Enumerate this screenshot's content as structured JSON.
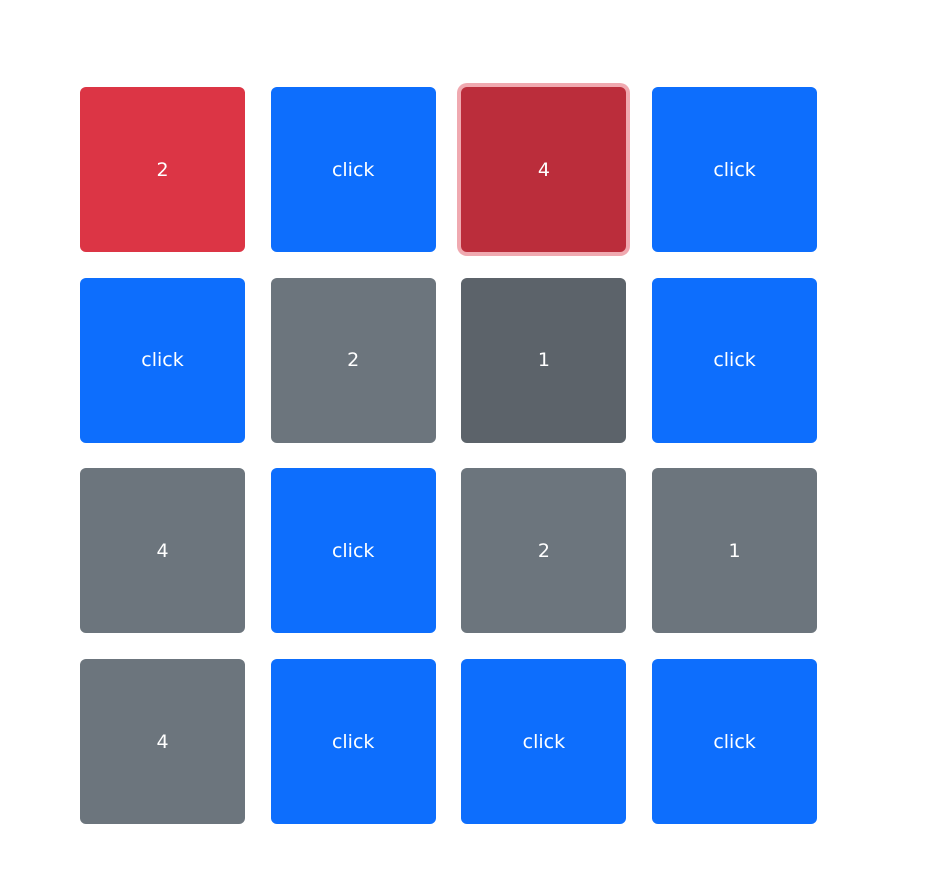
{
  "colors": {
    "hidden": "#0d6efd",
    "matched": "#6c757d",
    "matched_active": "#5c636a",
    "revealed": "#dc3545",
    "revealed_focus": "#bb2d3b"
  },
  "tiles": [
    {
      "label": "2",
      "state": "revealed"
    },
    {
      "label": "click",
      "state": "hidden"
    },
    {
      "label": "4",
      "state": "revealed-focus"
    },
    {
      "label": "click",
      "state": "hidden"
    },
    {
      "label": "click",
      "state": "hidden"
    },
    {
      "label": "2",
      "state": "matched"
    },
    {
      "label": "1",
      "state": "matched-active"
    },
    {
      "label": "click",
      "state": "hidden"
    },
    {
      "label": "4",
      "state": "matched"
    },
    {
      "label": "click",
      "state": "hidden"
    },
    {
      "label": "2",
      "state": "matched"
    },
    {
      "label": "1",
      "state": "matched"
    },
    {
      "label": "4",
      "state": "matched"
    },
    {
      "label": "click",
      "state": "hidden"
    },
    {
      "label": "click",
      "state": "hidden"
    },
    {
      "label": "click",
      "state": "hidden"
    }
  ]
}
